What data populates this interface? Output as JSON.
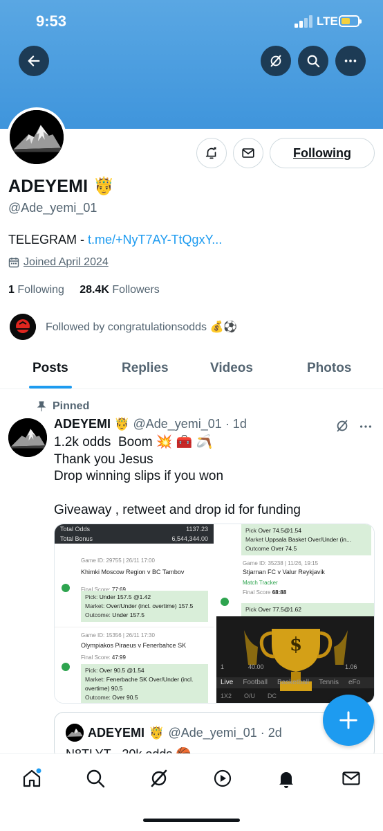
{
  "status_bar": {
    "time": "9:53",
    "network": "LTE"
  },
  "profile": {
    "name": "ADEYEMI",
    "name_emoji": "🤴",
    "handle": "@Ade_yemi_01",
    "bio_prefix": "TELEGRAM - ",
    "bio_link": "t.me/+NyT7AY-TtQgxY...",
    "joined": "Joined April 2024",
    "following_count": "1",
    "following_label": "Following",
    "followers_count": "28.4K",
    "followers_label": "Followers",
    "followed_by": "Followed by congratulationsodds 💰⚽",
    "follow_button": "Following"
  },
  "tabs": [
    {
      "label": "Posts",
      "active": true
    },
    {
      "label": "Replies",
      "active": false
    },
    {
      "label": "Videos",
      "active": false
    },
    {
      "label": "Photos",
      "active": false
    }
  ],
  "pinned_post": {
    "pinned_label": "Pinned",
    "author": "ADEYEMI",
    "author_emoji": "🤴",
    "handle_time": "@Ade_yemi_01 · 1d",
    "text": "1.2k odds  Boom 💥 🧰 🪃\nThank you Jesus\nDrop winning slips if you won\n\nGiveaway , retweet and drop id for funding",
    "media": {
      "left": {
        "total_odds_label": "Total Odds",
        "total_odds": "1137.23",
        "total_bonus_label": "Total Bonus",
        "total_bonus": "6,544,344.00",
        "game1": {
          "id": "Game ID: 29755 | 26/11 17:00",
          "teams": "Khimki Moscow Region v BC Tambov",
          "final_label": "Final Score:",
          "final": "77:69",
          "pick_label": "Pick:",
          "pick": "Under 157.5 @1.42",
          "market_label": "Market:",
          "market": "Over/Under (incl. overtime) 157.5",
          "outcome_label": "Outcome:",
          "outcome": "Under 157.5"
        },
        "game2": {
          "id": "Game ID: 15356 | 26/11 17:30",
          "teams": "Olympiakos Piraeus v Fenerbahce SK",
          "final_label": "Final Score:",
          "final": "47:99",
          "pick_label": "Pick:",
          "pick": "Over 90.5 @1.54",
          "market_label": "Market:",
          "market": "Fenerbache SK Over/Under (incl. overtime) 90.5",
          "outcome_label": "Outcome:",
          "outcome": "Over 90.5"
        }
      },
      "right_top": {
        "pick_label": "Pick",
        "pick": "Over 74.5@1.54",
        "market_label": "Market",
        "market": "Uppsala Basket Over/Under (in...",
        "outcome_label": "Outcome",
        "outcome": "Over 74.5",
        "game_id": "Game ID: 35238 | 11/26, 19:15",
        "teams": "Stjarnan FC v Valur Reykjavik",
        "tracker": "Match Tracker",
        "final_label": "Final Score",
        "final": "68:88",
        "pick2_label": "Pick",
        "pick2": "Over 77.5@1.62"
      },
      "right_bottom": {
        "trophy_symbol": "$",
        "odds_left": "1",
        "odds_mid": "40.00",
        "odds_right": "1.06",
        "menu": [
          "Live",
          "Football",
          "Basketball",
          "Tennis",
          "eFo"
        ],
        "bottom": [
          "1X2",
          "O/U",
          "DC"
        ]
      }
    }
  },
  "quote_post": {
    "author": "ADEYEMI",
    "author_emoji": "🤴",
    "handle_time": "@Ade_yemi_01 · 2d",
    "text": "N8TLYT - 20k odds 🏀"
  },
  "colors": {
    "accent": "#1d9bf0",
    "banner": "#4a9fe0",
    "text_secondary": "#536471"
  },
  "icons": {
    "top_bar": [
      "back-arrow-icon",
      "grok-icon",
      "search-icon",
      "more-icon"
    ],
    "bottom_nav": [
      "home-icon",
      "search-icon",
      "grok-icon",
      "video-play-icon",
      "notifications-bell-icon",
      "messages-envelope-icon"
    ]
  }
}
